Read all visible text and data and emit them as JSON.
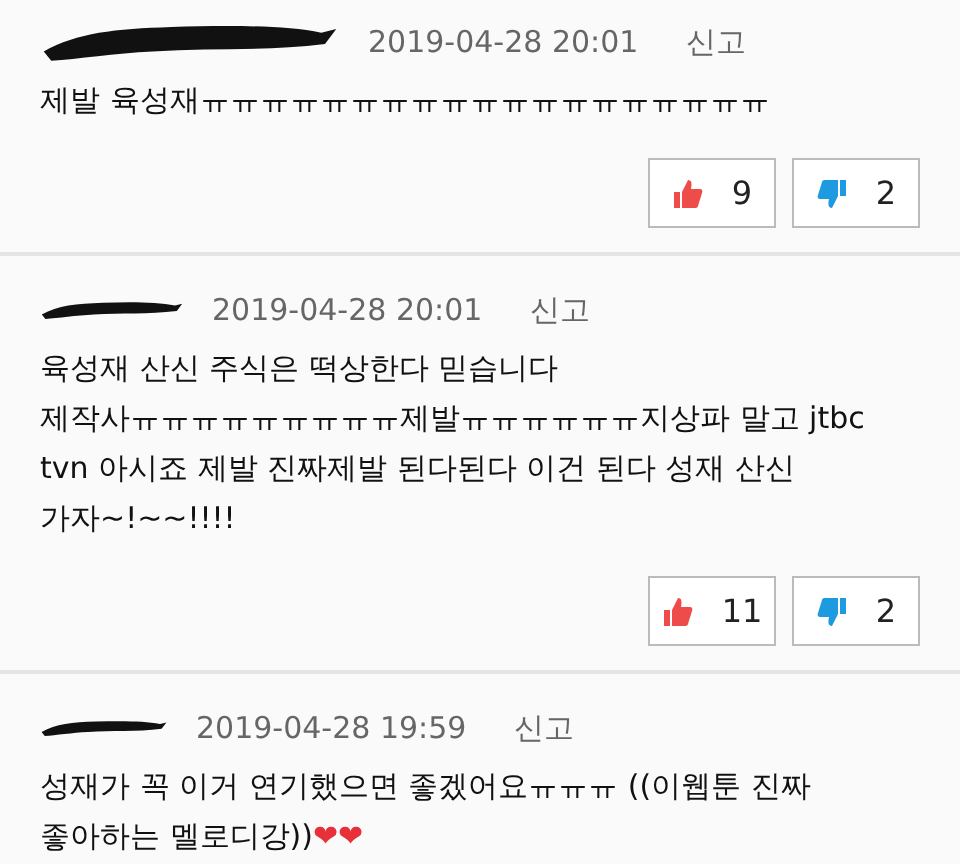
{
  "comments": [
    {
      "date": "2019-04-28 20:01",
      "report": "신고",
      "body": "제발 육성재ㅠㅠㅠㅠㅠㅠㅠㅠㅠㅠㅠㅠㅠㅠㅠㅠㅠㅠㅠ",
      "likes": "9",
      "dislikes": "2"
    },
    {
      "date": "2019-04-28 20:01",
      "report": "신고",
      "body": "육성재 산신 주식은 떡상한다 믿습니다\n제작사ㅠㅠㅠㅠㅠㅠㅠㅠㅠ제발ㅠㅠㅠㅠㅠㅠ지상파 말고 jtbc\ntvn 아시죠 제발 진짜제발 된다된다 이건 된다 성재 산신\n가자~!~~!!!!",
      "likes": "11",
      "dislikes": "2"
    },
    {
      "date": "2019-04-28 19:59",
      "report": "신고",
      "body": "성재가 꼭 이거 연기했으면 좋겠어요ㅠㅠㅠ ((이웹툰 진짜\n좋아하는 멜로디강))",
      "hearts": "❤❤"
    }
  ]
}
